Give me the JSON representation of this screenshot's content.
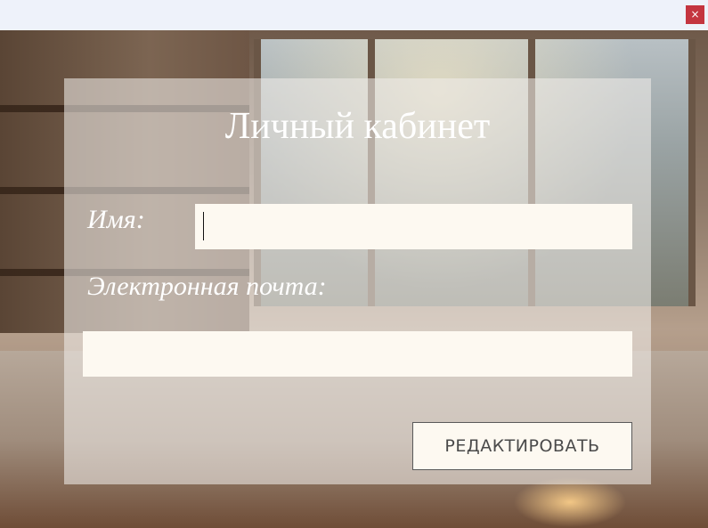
{
  "window": {
    "close_symbol": "×"
  },
  "profile": {
    "title": "Личный кабинет",
    "name_label": "Имя:",
    "name_value": "",
    "email_label": "Электронная почта:",
    "email_value": "",
    "edit_button": "РЕДАКТИРОВАТЬ"
  },
  "colors": {
    "close_button": "#c4353f",
    "field_background": "#fdf9f1",
    "title_text": "#ffffff"
  }
}
